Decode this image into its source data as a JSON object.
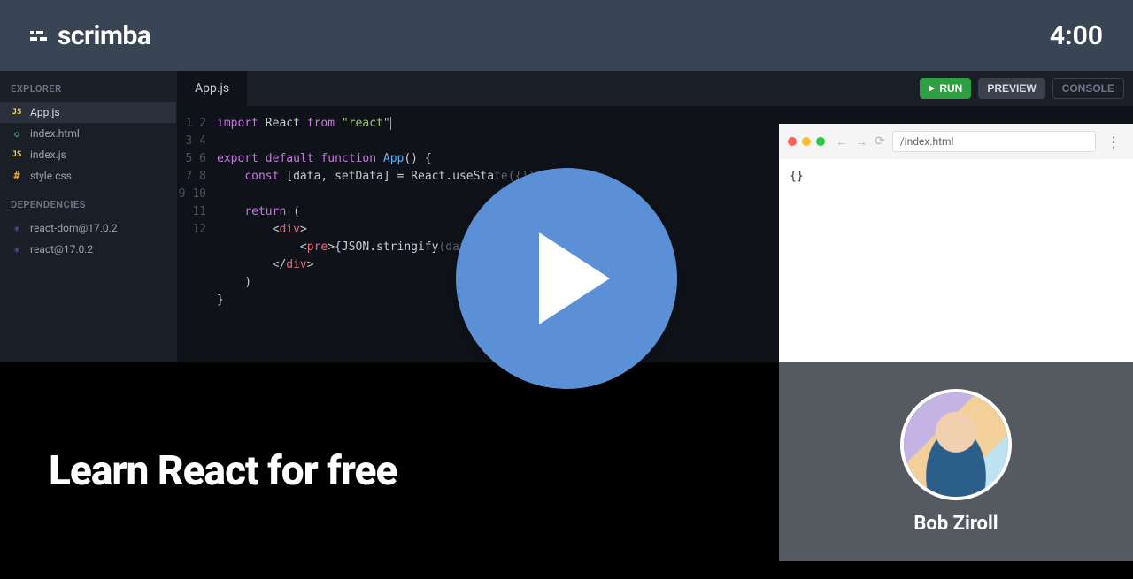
{
  "header": {
    "brand": "scrimba",
    "time": "4:00"
  },
  "sidebar": {
    "explorer_heading": "EXPLORER",
    "files": [
      {
        "icon": "JS",
        "icon_class": "js",
        "name": "App.js",
        "active": true
      },
      {
        "icon": "◇",
        "icon_class": "html",
        "name": "index.html",
        "active": false
      },
      {
        "icon": "JS",
        "icon_class": "js",
        "name": "index.js",
        "active": false
      },
      {
        "icon": "#",
        "icon_class": "css",
        "name": "style.css",
        "active": false
      }
    ],
    "deps_heading": "DEPENDENCIES",
    "deps": [
      {
        "name": "react-dom@17.0.2"
      },
      {
        "name": "react@17.0.2"
      }
    ]
  },
  "tabbar": {
    "active_tab": "App.js",
    "run_label": "RUN",
    "preview_label": "PREVIEW",
    "console_label": "CONSOLE"
  },
  "code": {
    "line_count": 12,
    "lines_html": [
      "<span class='kw'>import</span> React <span class='kw'>from</span> <span class='str'>\"react\"</span><span class='cursor'></span>",
      "",
      "<span class='kw'>export</span> <span class='kw'>default</span> <span class='def'>function</span> <span class='fn'>App</span>() {",
      "    <span class='const'>const</span> [data, setData] = React.useSta<span class='dim'>te({})</span>",
      "",
      "    <span class='kw'>return</span> (",
      "        &lt;<span class='tag'>div</span>&gt;",
      "            &lt;<span class='tag'>pre</span>&gt;{JSON.stringify<span class='dim'>(data, null, 2)}&lt;/pre&gt;</span>",
      "        &lt;/<span class='tag'>div</span>&gt;",
      "    )",
      "}",
      ""
    ]
  },
  "preview": {
    "address": "/index.html",
    "output": "{}"
  },
  "hero": {
    "title": "Learn React for free"
  },
  "instructor": {
    "name": "Bob Ziroll"
  }
}
